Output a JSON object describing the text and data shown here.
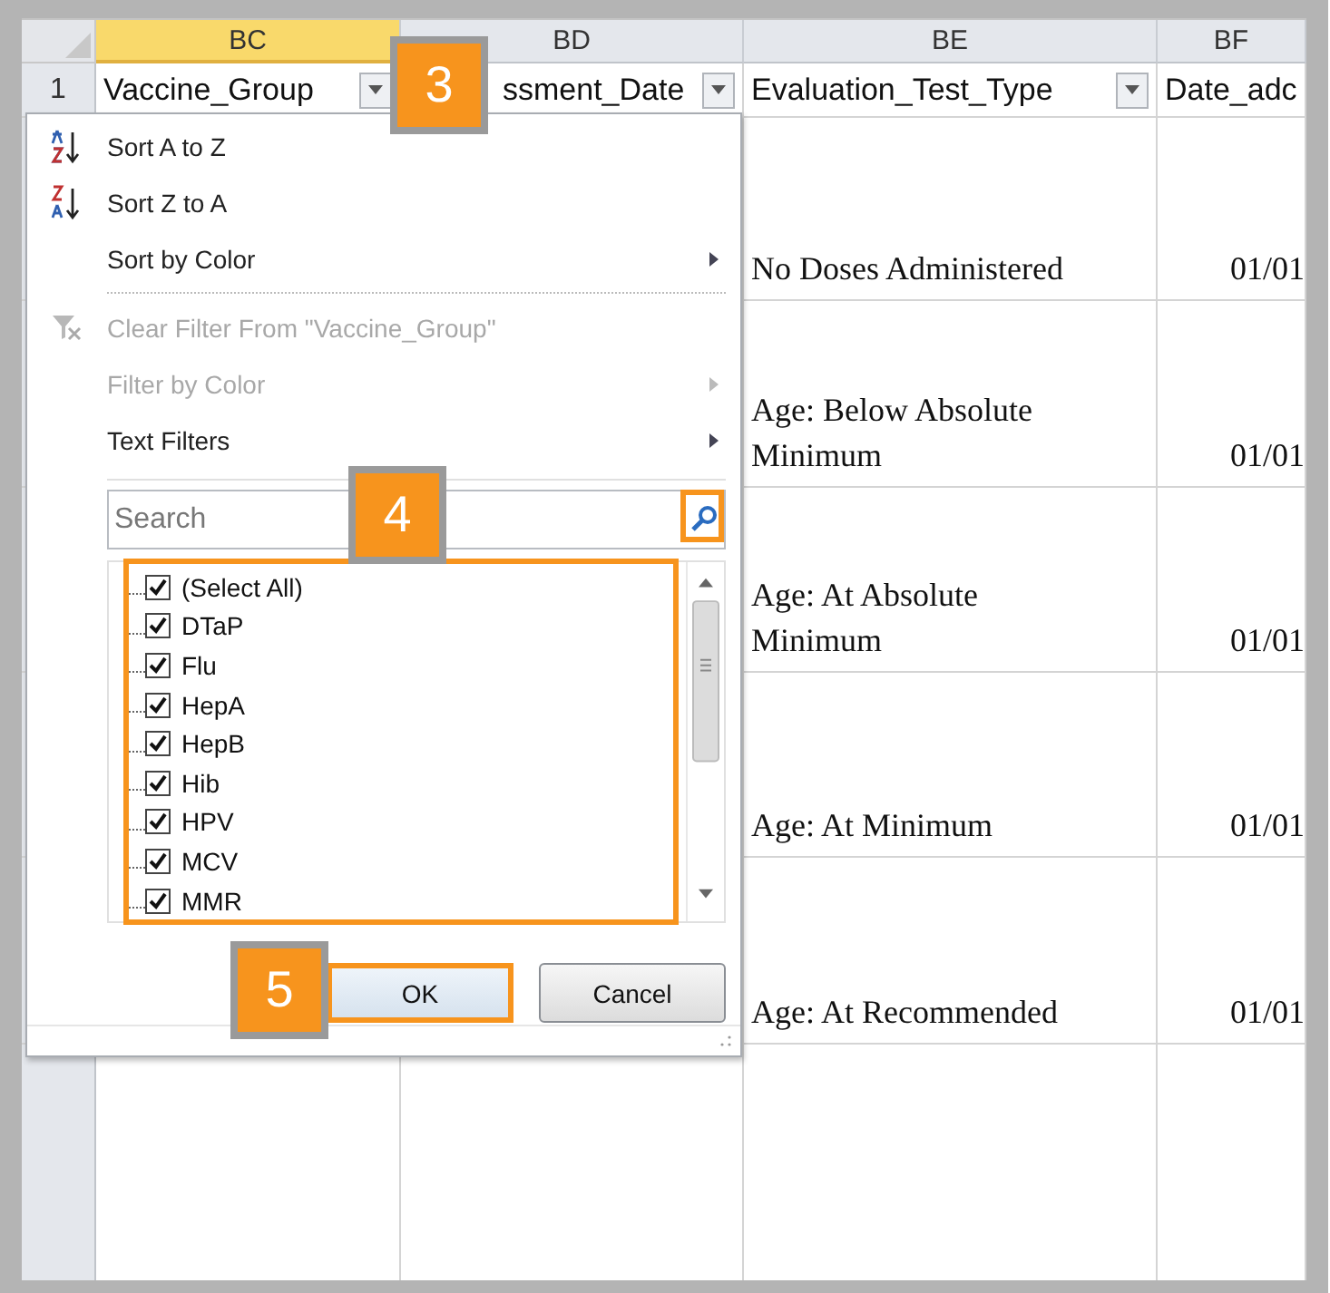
{
  "sheet": {
    "columns": [
      {
        "label": "BC",
        "selected": true
      },
      {
        "label": "BD",
        "selected": false
      },
      {
        "label": "BE",
        "selected": false
      },
      {
        "label": "BF",
        "selected": false
      }
    ],
    "header_row": {
      "number": "1",
      "cells": [
        {
          "text": "Vaccine_Group",
          "filter": true
        },
        {
          "text": "ssment_Date",
          "filter": true
        },
        {
          "text": "Evaluation_Test_Type",
          "filter": true
        },
        {
          "text": "Date_adc",
          "filter": false
        }
      ]
    },
    "rows": [
      {
        "evaluation": "No Doses Administered",
        "date": "01/01"
      },
      {
        "evaluation": "Age: Below Absolute Minimum",
        "date": "01/01"
      },
      {
        "evaluation": "Age: At Absolute Minimum",
        "date": "01/01"
      },
      {
        "evaluation": "Age: At Minimum",
        "date": "01/01"
      },
      {
        "evaluation": "Age: At Recommended",
        "date": "01/01"
      }
    ]
  },
  "filter_menu": {
    "items": [
      {
        "kind": "sort_asc",
        "label": "Sort A to Z",
        "disabled": false,
        "submenu": false
      },
      {
        "kind": "sort_desc",
        "label": "Sort Z to A",
        "disabled": false,
        "submenu": false
      },
      {
        "kind": "plain",
        "label": "Sort by Color",
        "disabled": false,
        "submenu": true
      },
      {
        "kind": "separator"
      },
      {
        "kind": "clear",
        "label": "Clear Filter From \"Vaccine_Group\"",
        "disabled": true,
        "submenu": false
      },
      {
        "kind": "plain",
        "label": "Filter by Color",
        "disabled": true,
        "submenu": true
      },
      {
        "kind": "plain",
        "label": "Text Filters",
        "disabled": false,
        "submenu": true
      }
    ],
    "search": {
      "placeholder": "Search"
    },
    "values": [
      {
        "label": "(Select All)",
        "checked": true
      },
      {
        "label": "DTaP",
        "checked": true
      },
      {
        "label": "Flu",
        "checked": true
      },
      {
        "label": "HepA",
        "checked": true
      },
      {
        "label": "HepB",
        "checked": true
      },
      {
        "label": "Hib",
        "checked": true
      },
      {
        "label": "HPV",
        "checked": true
      },
      {
        "label": "MCV",
        "checked": true
      },
      {
        "label": "MMR",
        "checked": true
      }
    ],
    "buttons": [
      {
        "label": "OK",
        "kind": "primary"
      },
      {
        "label": "Cancel",
        "kind": "secondary"
      }
    ]
  },
  "callouts": [
    {
      "number": "3"
    },
    {
      "number": "4"
    },
    {
      "number": "5"
    }
  ]
}
